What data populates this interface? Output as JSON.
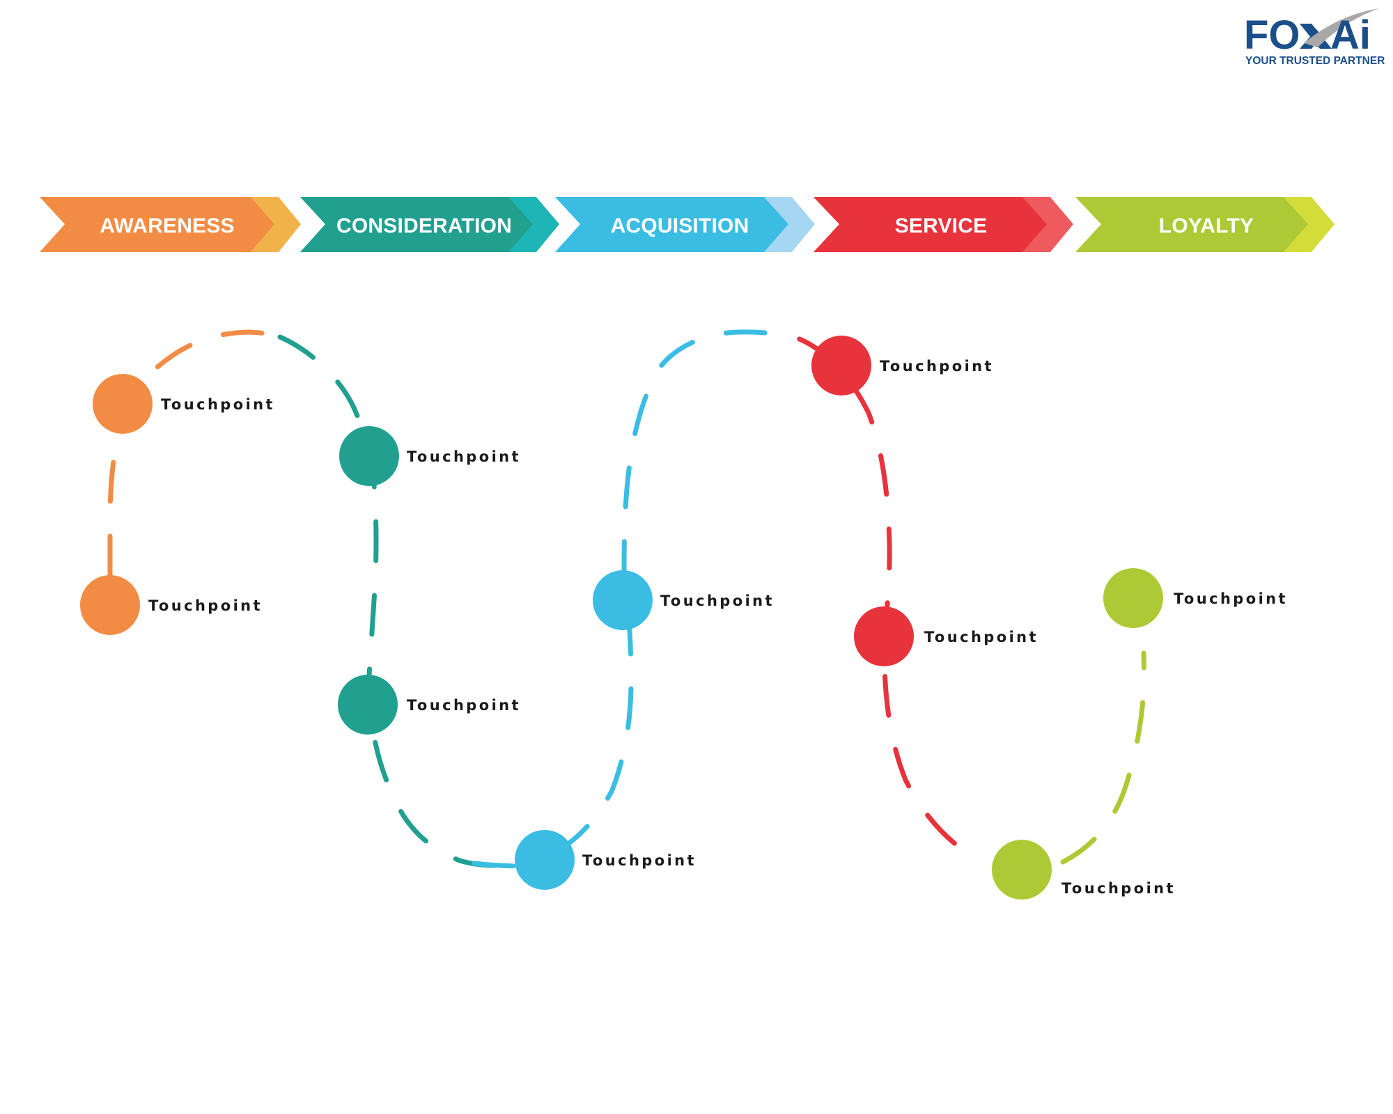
{
  "logo": {
    "brand_left": "FO",
    "brand_right": "Ai",
    "tagline": "YOUR TRUSTED PARTNER",
    "color_primary": "#1B4F8A",
    "color_swoosh": "#A8A8A8"
  },
  "stages": [
    {
      "label": "AWARENESS",
      "color": "#F28C44",
      "accent": "#F2B24A"
    },
    {
      "label": "CONSIDERATION",
      "color": "#21A090",
      "accent": "#1DB5B5"
    },
    {
      "label": "ACQUISITION",
      "color": "#3BBDE3",
      "accent": "#A5D6F2"
    },
    {
      "label": "SERVICE",
      "color": "#E8323C",
      "accent": "#EE5A5E"
    },
    {
      "label": "LOYALTY",
      "color": "#ADCA36",
      "accent": "#D4DC3A"
    }
  ],
  "touchpoints": [
    {
      "stage": "AWARENESS",
      "label": "Touchpoint"
    },
    {
      "stage": "AWARENESS",
      "label": "Touchpoint"
    },
    {
      "stage": "CONSIDERATION",
      "label": "Touchpoint"
    },
    {
      "stage": "CONSIDERATION",
      "label": "Touchpoint"
    },
    {
      "stage": "ACQUISITION",
      "label": "Touchpoint"
    },
    {
      "stage": "ACQUISITION",
      "label": "Touchpoint"
    },
    {
      "stage": "SERVICE",
      "label": "Touchpoint"
    },
    {
      "stage": "SERVICE",
      "label": "Touchpoint"
    },
    {
      "stage": "LOYALTY",
      "label": "Touchpoint"
    },
    {
      "stage": "LOYALTY",
      "label": "Touchpoint"
    }
  ]
}
